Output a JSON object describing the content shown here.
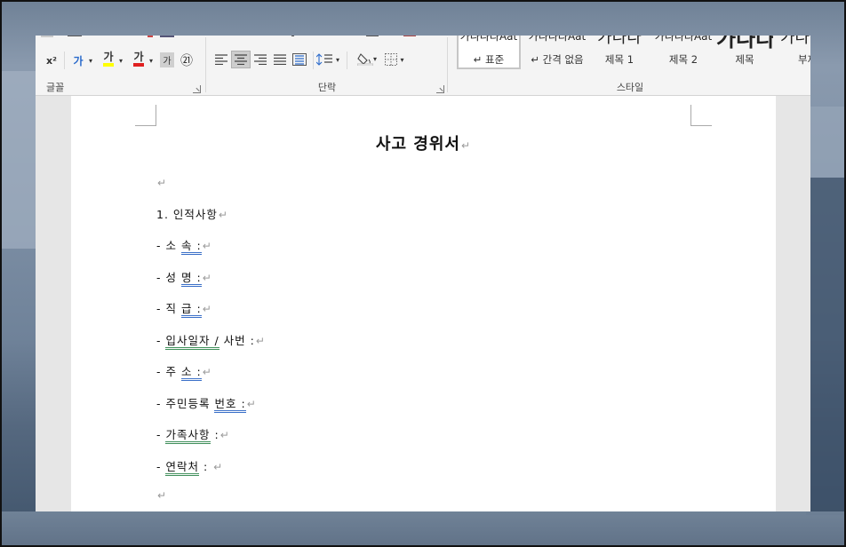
{
  "ribbon": {
    "font_group_label": "글꼴",
    "paragraph_group_label": "단락",
    "styles_group_label": "스타일",
    "font_buttons": {
      "superscript": "x²",
      "text_effects": "가",
      "highlight": "가",
      "font_color": "가",
      "char_shading": "가",
      "enclosed_char": "㉑"
    },
    "styles": [
      {
        "sample": "가나다라Aat",
        "name": "↵ 표준",
        "selected": true
      },
      {
        "sample": "가나다라Aat",
        "name": "↵ 간격 없음",
        "selected": false
      },
      {
        "sample": "가나다",
        "name": "제목 1",
        "selected": false
      },
      {
        "sample": "가나다라Aat",
        "name": "제목 2",
        "selected": false
      },
      {
        "sample": "가나다",
        "name": "제목",
        "selected": false
      },
      {
        "sample": "가나",
        "name": "부제",
        "selected": false
      }
    ]
  },
  "document": {
    "title": "사고 경위서",
    "section1": "1. 인적사항",
    "fields": [
      {
        "prefix": "- 소 속 ",
        "field": ":"
      },
      {
        "prefix": "- 성 명 ",
        "field": ":"
      },
      {
        "prefix": "- 직 급 ",
        "field": ":"
      },
      {
        "prefix": "- 입사일자 / 사번 ",
        "field": ":"
      },
      {
        "prefix": "- 주 소 ",
        "field": ":"
      },
      {
        "prefix": "- 주민등록 번호 ",
        "field": ":"
      },
      {
        "prefix": "- 가족사항 ",
        "field": ":"
      },
      {
        "prefix": "- 연락처 ",
        "field": ":"
      }
    ],
    "field_display": [
      {
        "dash": "- ",
        "a": "소",
        "b": "속",
        "c": " :"
      },
      {
        "dash": "- ",
        "a": "성",
        "b": "명",
        "c": " :"
      },
      {
        "dash": "- ",
        "a": "직",
        "b": "급",
        "c": " :"
      },
      {
        "dash": "- ",
        "a": "입사일자 /",
        "b": "사번",
        "c": " :"
      },
      {
        "dash": "- ",
        "a": "주",
        "b": "소",
        "c": " :"
      },
      {
        "dash": "- ",
        "a": "주민등록",
        "b": "번호",
        "c": " :"
      },
      {
        "dash": "- ",
        "a": "가족사항",
        "b": "",
        "c": " :"
      },
      {
        "dash": "- ",
        "a": "연락처",
        "b": "",
        "c": " :"
      }
    ],
    "paragraph_mark": "↵"
  },
  "colors": {
    "accent_underline": "#3a6fc8",
    "green_underline": "#3f8f5a",
    "highlight": "#ffff00",
    "font_color": "#e02020"
  }
}
